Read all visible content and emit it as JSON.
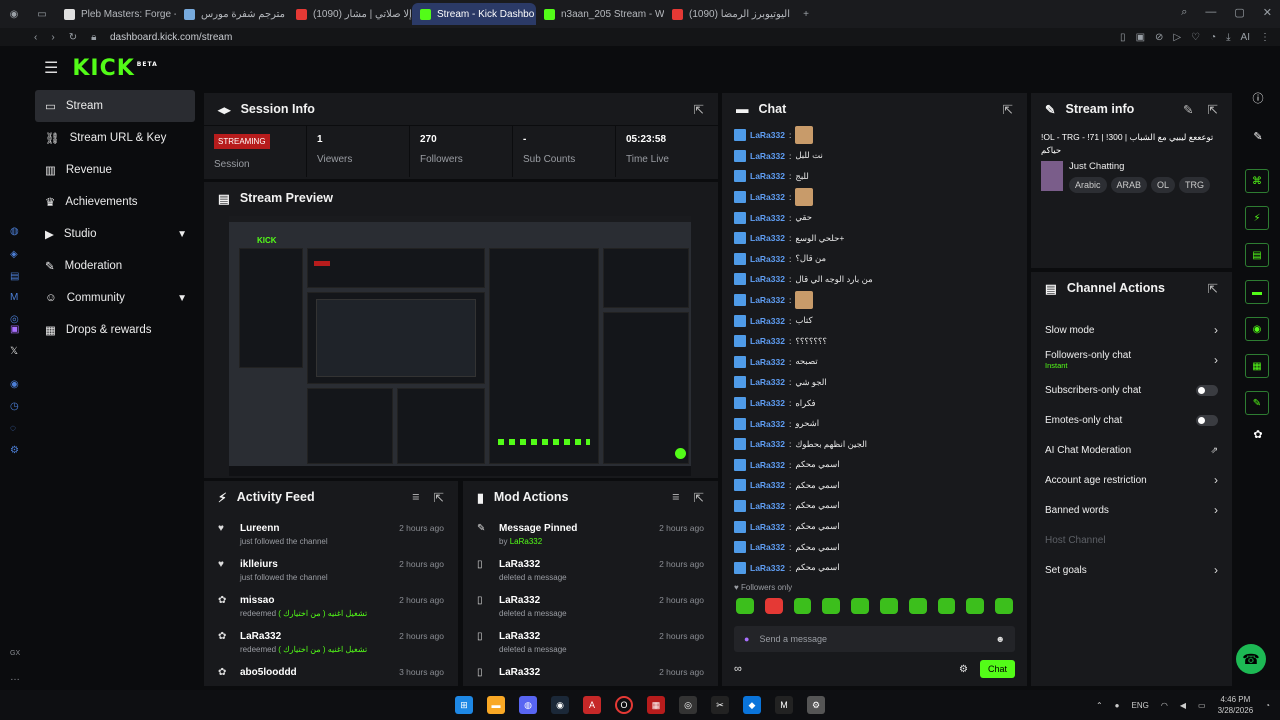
{
  "browser": {
    "tabs": [
      {
        "label": "Pleb Masters: Forge - GTA",
        "color": "#e0e0e0"
      },
      {
        "label": "مترجم شفرة مورس",
        "color": "#7ad"
      },
      {
        "label": "(1090) إلا صلاتي | مشار...",
        "color": "#e53935"
      },
      {
        "label": "Stream - Kick Dashbo",
        "color": "#53fc18"
      },
      {
        "label": "n3aan_205 Stream - Watc",
        "color": "#53fc18"
      },
      {
        "label": "(1090) تحدي اليوتيوبرز الرمضا...",
        "color": "#e53935"
      }
    ],
    "url": "dashboard.kick.com/stream"
  },
  "brand": {
    "logo": "KICK",
    "beta": "BETA"
  },
  "sidebar": {
    "items": [
      {
        "label": "Stream",
        "icon": "stream-icon"
      },
      {
        "label": "Stream URL & Key",
        "icon": "link-icon"
      },
      {
        "label": "Revenue",
        "icon": "chart-icon"
      },
      {
        "label": "Achievements",
        "icon": "trophy-icon"
      },
      {
        "label": "Studio",
        "icon": "video-icon"
      },
      {
        "label": "Moderation",
        "icon": "wrench-icon"
      },
      {
        "label": "Community",
        "icon": "people-icon"
      },
      {
        "label": "Drops & rewards",
        "icon": "gift-icon"
      }
    ]
  },
  "session": {
    "title": "Session Info",
    "status": "STREAMING",
    "status_label": "Session",
    "viewers": "1",
    "viewers_label": "Viewers",
    "followers": "270",
    "followers_label": "Followers",
    "subs": "-",
    "subs_label": "Sub Counts",
    "time": "05:23:58",
    "time_label": "Time Live"
  },
  "preview": {
    "title": "Stream Preview"
  },
  "activity": {
    "title": "Activity Feed",
    "items": [
      {
        "name": "Lureenn",
        "sub": "just followed the channel",
        "time": "2 hours ago"
      },
      {
        "name": "iklleiurs",
        "sub": "just followed the channel",
        "time": "2 hours ago"
      },
      {
        "name": "missao",
        "sub": "redeemed",
        "reward": "تشغيل اغنيه ( من اختيارك )",
        "time": "2 hours ago"
      },
      {
        "name": "LaRa332",
        "sub": "redeemed",
        "reward": "تشغيل اغنيه ( من اختيارك )",
        "time": "2 hours ago"
      },
      {
        "name": "abo5looddd",
        "sub": "",
        "time": "3 hours ago"
      }
    ]
  },
  "mod": {
    "title": "Mod Actions",
    "items": [
      {
        "name": "Message Pinned",
        "sub": "by",
        "by": "LaRa332",
        "time": "2 hours ago"
      },
      {
        "name": "LaRa332",
        "sub": "deleted a message",
        "time": "2 hours ago"
      },
      {
        "name": "LaRa332",
        "sub": "deleted a message",
        "time": "2 hours ago"
      },
      {
        "name": "LaRa332",
        "sub": "deleted a message",
        "time": "2 hours ago"
      },
      {
        "name": "LaRa332",
        "sub": "",
        "time": "2 hours ago"
      }
    ]
  },
  "chat": {
    "title": "Chat",
    "messages": [
      {
        "user": "LaRa332",
        "text": "",
        "emote": true
      },
      {
        "user": "LaRa332",
        "text": "نت للبل"
      },
      {
        "user": "LaRa332",
        "text": "للبج"
      },
      {
        "user": "LaRa332",
        "text": "",
        "emote": true
      },
      {
        "user": "LaRa332",
        "text": "حقي"
      },
      {
        "user": "LaRa332",
        "text": "حلحي الوسع+"
      },
      {
        "user": "LaRa332",
        "text": "من قال؟"
      },
      {
        "user": "LaRa332",
        "text": "من بارد الوجه الي قال"
      },
      {
        "user": "LaRa332",
        "text": "",
        "emote": true
      },
      {
        "user": "LaRa332",
        "text": "كتاب"
      },
      {
        "user": "LaRa332",
        "text": "؟؟؟؟؟؟؟"
      },
      {
        "user": "LaRa332",
        "text": "تصبحه"
      },
      {
        "user": "LaRa332",
        "text": "الجو شي"
      },
      {
        "user": "LaRa332",
        "text": "فكراه"
      },
      {
        "user": "LaRa332",
        "text": "اشحرو"
      },
      {
        "user": "LaRa332",
        "text": "الجين انظهم بحطوك"
      },
      {
        "user": "LaRa332",
        "text": "اسمي محكم"
      },
      {
        "user": "LaRa332",
        "text": "اسمي محكم"
      },
      {
        "user": "LaRa332",
        "text": "اسمي محكم"
      },
      {
        "user": "LaRa332",
        "text": "اسمي محكم"
      },
      {
        "user": "LaRa332",
        "text": "اسمي محكم"
      },
      {
        "user": "LaRa332",
        "text": "اسمي محكم"
      }
    ],
    "followers_only": "Followers only",
    "input_placeholder": "Send a message",
    "send": "Chat"
  },
  "stream_info": {
    "title": "Stream info",
    "stream_title": "!OL - TRG - !71 | !300 | توعععع ليبيي مع الشباب حياكم",
    "category": "Just Chatting",
    "tags": [
      "Arabic",
      "ARAB",
      "OL",
      "TRG"
    ]
  },
  "channel_actions": {
    "title": "Channel Actions",
    "items": [
      {
        "label": "Slow mode",
        "type": "arrow"
      },
      {
        "label": "Followers-only chat",
        "sub": "Instant",
        "type": "arrow"
      },
      {
        "label": "Subscribers-only chat",
        "type": "toggle"
      },
      {
        "label": "Emotes-only chat",
        "type": "toggle"
      },
      {
        "label": "AI Chat Moderation",
        "type": "external"
      },
      {
        "label": "Account age restriction",
        "type": "arrow"
      },
      {
        "label": "Banned words",
        "type": "arrow"
      },
      {
        "label": "Host Channel",
        "type": "disabled"
      },
      {
        "label": "Set goals",
        "type": "arrow"
      }
    ]
  },
  "taskbar": {
    "clock": "4:46 PM",
    "date": "3/28/2026",
    "lang": "ENG"
  },
  "colors": {
    "accent": "#53fc18",
    "panel": "#18191c",
    "bg": "#0b0c0e",
    "live": "#b71c1c"
  }
}
